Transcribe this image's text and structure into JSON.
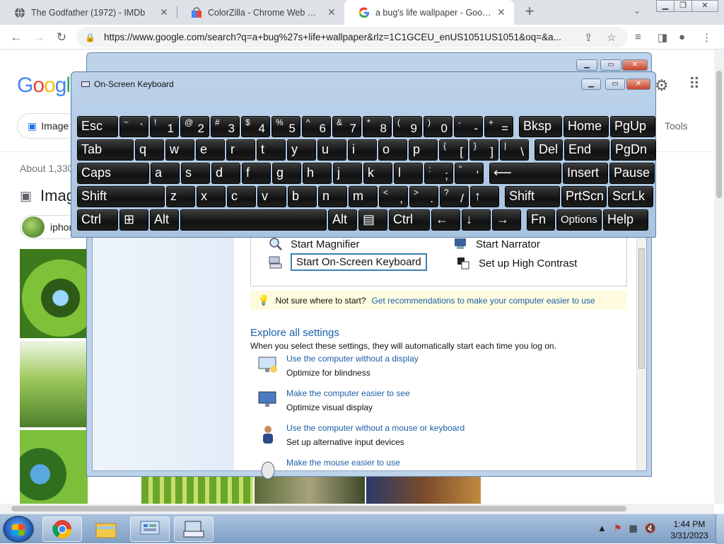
{
  "browser": {
    "tabs": [
      {
        "title": "The Godfather (1972) - IMDb"
      },
      {
        "title": "ColorZilla - Chrome Web Store"
      },
      {
        "title": "a bug's life wallpaper - Google S"
      }
    ],
    "url": "https://www.google.com/search?q=a+bug%27s+life+wallpaper&rlz=1C1GCEU_enUS1051US1051&oq=&a..."
  },
  "google": {
    "logo": "Googl",
    "chip_images": "Image",
    "tools": "Tools",
    "about": "About 1,330",
    "images_heading": "Imag",
    "suggestion": "iphon"
  },
  "ease_of_access": {
    "quick": {
      "magnifier": "Start Magnifier",
      "narrator": "Start Narrator",
      "osk": "Start On-Screen Keyboard",
      "high_contrast": "Set up High Contrast"
    },
    "tip_prefix": "Not sure where to start?",
    "tip_link": "Get recommendations to make your computer easier to use",
    "explore_heading": "Explore all settings",
    "explore_desc": "When you select these settings, they will automatically start each time you log on.",
    "settings": [
      {
        "link": "Use the computer without a display",
        "sub": "Optimize for blindness"
      },
      {
        "link": "Make the computer easier to see",
        "sub": "Optimize visual display"
      },
      {
        "link": "Use the computer without a mouse or keyboard",
        "sub": "Set up alternative input devices"
      },
      {
        "link": "Make the mouse easier to use",
        "sub": ""
      }
    ]
  },
  "osk": {
    "title": "On-Screen Keyboard",
    "rows": [
      [
        {
          "k": "Esc",
          "w": 58
        },
        {
          "s": "~",
          "l": "`",
          "w": 41
        },
        {
          "s": "!",
          "l": "1",
          "w": 41
        },
        {
          "s": "@",
          "l": "2",
          "w": 41
        },
        {
          "s": "#",
          "l": "3",
          "w": 41
        },
        {
          "s": "$",
          "l": "4",
          "w": 41
        },
        {
          "s": "%",
          "l": "5",
          "w": 41
        },
        {
          "s": "^",
          "l": "6",
          "w": 41
        },
        {
          "s": "&",
          "l": "7",
          "w": 41
        },
        {
          "s": "*",
          "l": "8",
          "w": 41
        },
        {
          "s": "(",
          "l": "9",
          "w": 41
        },
        {
          "s": ")",
          "l": "0",
          "w": 41
        },
        {
          "s": "-",
          "l": "-",
          "w": 41
        },
        {
          "s": "+",
          "l": "=",
          "w": 41
        },
        {
          "k": "Bksp",
          "w": 61,
          "gap": 6
        },
        {
          "k": "Home",
          "w": 64
        },
        {
          "k": "PgUp",
          "w": 64
        }
      ],
      [
        {
          "k": "Tab",
          "w": 80
        },
        {
          "k": "q",
          "w": 41
        },
        {
          "k": "w",
          "w": 41
        },
        {
          "k": "e",
          "w": 41
        },
        {
          "k": "r",
          "w": 41
        },
        {
          "k": "t",
          "w": 41
        },
        {
          "k": "y",
          "w": 41
        },
        {
          "k": "u",
          "w": 41
        },
        {
          "k": "i",
          "w": 41
        },
        {
          "k": "o",
          "w": 41
        },
        {
          "k": "p",
          "w": 41
        },
        {
          "s": "{",
          "l": "[",
          "w": 41
        },
        {
          "s": "}",
          "l": "]",
          "w": 41
        },
        {
          "s": "|",
          "l": "\\",
          "w": 41
        },
        {
          "k": "Del",
          "w": 40,
          "gap": 6
        },
        {
          "k": "End",
          "w": 64
        },
        {
          "k": "PgDn",
          "w": 64
        }
      ],
      [
        {
          "k": "Caps",
          "w": 102
        },
        {
          "k": "a",
          "w": 41
        },
        {
          "k": "s",
          "w": 41
        },
        {
          "k": "d",
          "w": 41
        },
        {
          "k": "f",
          "w": 41
        },
        {
          "k": "g",
          "w": 41
        },
        {
          "k": "h",
          "w": 41
        },
        {
          "k": "j",
          "w": 41
        },
        {
          "k": "k",
          "w": 41
        },
        {
          "k": "l",
          "w": 41
        },
        {
          "s": ":",
          "l": ";",
          "w": 41
        },
        {
          "s": "\"",
          "l": "'",
          "w": 41
        },
        {
          "k": "⟵",
          "w": 102,
          "gap": 6
        },
        {
          "k": "Insert",
          "w": 64
        },
        {
          "k": "Pause",
          "w": 64
        }
      ],
      [
        {
          "k": "Shift",
          "w": 124
        },
        {
          "k": "z",
          "w": 41
        },
        {
          "k": "x",
          "w": 41
        },
        {
          "k": "c",
          "w": 41
        },
        {
          "k": "v",
          "w": 41
        },
        {
          "k": "b",
          "w": 41
        },
        {
          "k": "n",
          "w": 41
        },
        {
          "k": "m",
          "w": 41
        },
        {
          "s": "<",
          "l": ",",
          "w": 41
        },
        {
          "s": ">",
          "l": ".",
          "w": 41
        },
        {
          "s": "?",
          "l": "/",
          "w": 41
        },
        {
          "k": "↑",
          "w": 41
        },
        {
          "k": "Shift",
          "w": 78,
          "gap": 6
        },
        {
          "k": "PrtScn",
          "w": 64
        },
        {
          "k": "ScrLk",
          "w": 64
        }
      ],
      [
        {
          "k": "Ctrl",
          "w": 58
        },
        {
          "k": "⊞",
          "w": 41
        },
        {
          "k": "Alt",
          "w": 41
        },
        {
          "k": " ",
          "w": 207
        },
        {
          "k": "Alt",
          "w": 41
        },
        {
          "k": "▤",
          "w": 41
        },
        {
          "k": "Ctrl",
          "w": 58
        },
        {
          "k": "←",
          "w": 41
        },
        {
          "k": "↓",
          "w": 41
        },
        {
          "k": "→",
          "w": 41
        },
        {
          "k": "Fn",
          "w": 40,
          "gap": 6
        },
        {
          "k": "Options",
          "w": 64,
          "opt": true
        },
        {
          "k": "Help",
          "w": 64
        }
      ]
    ]
  },
  "taskbar": {
    "time": "1:44 PM",
    "date": "3/31/2023"
  },
  "colors": {
    "link_blue": "#1c5fa8",
    "key_black": "#111111",
    "win7_frame": "#bcd3ea"
  }
}
